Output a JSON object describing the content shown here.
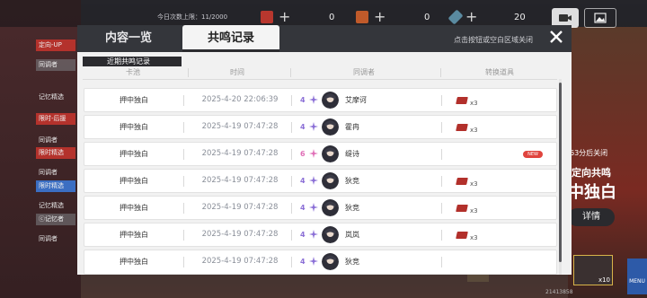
{
  "header": {
    "daily_count_text": "今日次数上限：11/2000",
    "resources": [
      {
        "icon": "currency-badge-icon",
        "value": "0"
      },
      {
        "icon": "crystal-icon",
        "value": "0"
      },
      {
        "icon": "tuning-fork-icon",
        "value": "20"
      }
    ]
  },
  "sidebar": {
    "items": [
      "定向-UP",
      "同调者",
      "记忆精选",
      "限时-后援",
      "同调者",
      "限时精选",
      "同调者",
      "限时精选",
      "记忆精选",
      "ⓒ记忆者",
      "同调者"
    ]
  },
  "right_panel": {
    "countdown": "63分后关闭",
    "banner_title": "定向共鸣",
    "banner_name": "中独白",
    "detail_button": "详情",
    "menu_label": "MENU",
    "item_count": "x10",
    "uid": "21413858"
  },
  "modal": {
    "tabs": [
      {
        "label": "内容一览",
        "active": false
      },
      {
        "label": "共鸣记录",
        "active": true
      }
    ],
    "close_hint": "点击按钮或空白区域关闭",
    "section_label": "近期共鸣记录",
    "columns": {
      "pool": "卡池",
      "time": "时间",
      "character": "同调者",
      "reward": "转换道具"
    },
    "rows": [
      {
        "pool": "押中独白",
        "time": "2025-4-20  22:06:39",
        "rarity": "4",
        "name": "艾摩诃",
        "reward_qty": "x3",
        "new": false
      },
      {
        "pool": "押中独白",
        "time": "2025-4-19  07:47:28",
        "rarity": "4",
        "name": "霍冉",
        "reward_qty": "x3",
        "new": false
      },
      {
        "pool": "押中独白",
        "time": "2025-4-19  07:47:28",
        "rarity": "6",
        "name": "缇诗",
        "reward_qty": "",
        "new": true,
        "badge": "NEW"
      },
      {
        "pool": "押中独白",
        "time": "2025-4-19  07:47:28",
        "rarity": "4",
        "name": "狄竞",
        "reward_qty": "x3",
        "new": false
      },
      {
        "pool": "押中独白",
        "time": "2025-4-19  07:47:28",
        "rarity": "4",
        "name": "狄竞",
        "reward_qty": "x3",
        "new": false
      },
      {
        "pool": "押中独白",
        "time": "2025-4-19  07:47:28",
        "rarity": "4",
        "name": "岚岚",
        "reward_qty": "x3",
        "new": false
      },
      {
        "pool": "押中独白",
        "time": "2025-4-19  07:47:28",
        "rarity": "4",
        "name": "狄竞",
        "reward_qty": "",
        "new": false
      }
    ]
  },
  "colors": {
    "rarity4": "#8b6fd6",
    "rarity6": "#e06fb7",
    "header_dark": "#34363b",
    "item_red": "#b2302b"
  }
}
